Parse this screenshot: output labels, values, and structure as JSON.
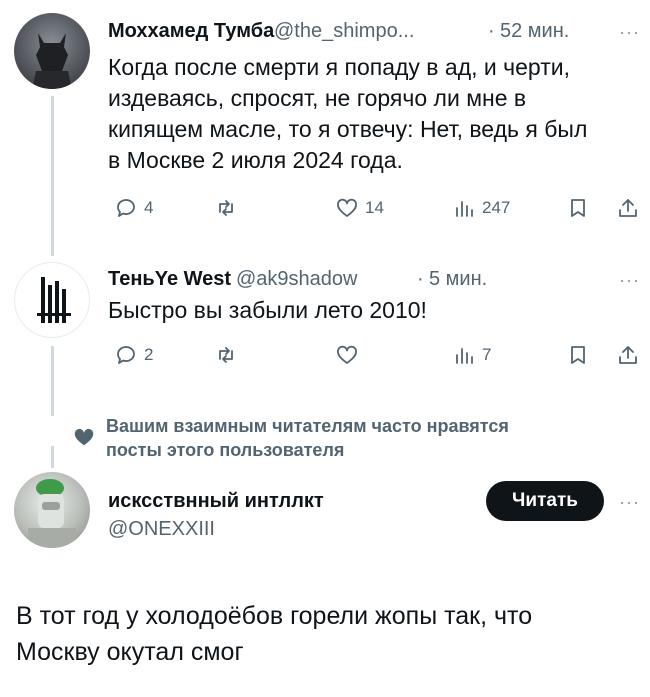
{
  "tweet1": {
    "name": "Моххамед Тумба",
    "handle": "@the_shimpo...",
    "sep": "·",
    "time": "52 мин.",
    "text_lines": [
      "Когда после смерти я попаду в ад, и черти,",
      "издеваясь, спросят, не горячо ли мне в",
      "кипящем масле, то я отвечу: Нет, ведь я был",
      "в Москве 2 июля 2024 года."
    ],
    "replies": "4",
    "reposts": "",
    "likes": "14",
    "views": "247"
  },
  "tweet2": {
    "name": "ТеньYe West",
    "handle": "@ak9shadow",
    "sep": "·",
    "time": "5 мин.",
    "text": "Быстро вы забыли лето 2010!",
    "replies": "2",
    "reposts": "",
    "likes": "",
    "views": "7"
  },
  "suggestion": {
    "lines": [
      "Вашим взаимным читателям часто нравятся",
      "посты этого пользователя"
    ]
  },
  "profile": {
    "name": "исксствнный интллкт",
    "handle": "@ONEXXIII",
    "follow_label": "Читать"
  },
  "main_text_lines": [
    "В тот год у холодоёбов горели жопы так, что",
    "Москву окутал смог"
  ],
  "more_label": "···",
  "icons": [
    "reply-icon",
    "repost-icon",
    "like-icon",
    "views-icon",
    "bookmark-icon",
    "share-icon",
    "heart-icon"
  ],
  "colors": {
    "text": "#0f1419",
    "secondary": "#536471",
    "line": "#cfd9de",
    "button": "#0f1419"
  }
}
